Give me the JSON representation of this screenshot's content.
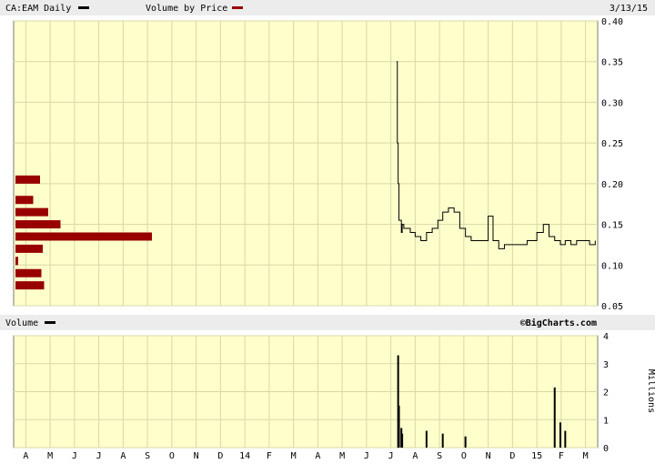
{
  "header": {
    "symbol_label": "CA:EAM Daily",
    "vbp_label": "Volume by Price",
    "date": "3/13/15"
  },
  "volume_header": {
    "label": "Volume",
    "watermark": "©BigCharts.com"
  },
  "colors": {
    "plot_bg": "#ffffcc",
    "grid": "#d8d8a8",
    "price_line": "#000000",
    "vbp_bar": "#990000",
    "bar_header": "#ececec"
  },
  "chart_data": [
    {
      "type": "line",
      "series": [
        {
          "values_x": [
            "2014-07-08",
            "2014-07-09",
            "2014-07-10",
            "2014-07-11",
            "2014-07-14",
            "2014-07-15",
            "2014-07-17",
            "2014-07-21",
            "2014-07-25",
            "2014-07-31",
            "2014-08-08",
            "2014-08-15",
            "2014-08-22",
            "2014-08-29",
            "2014-09-05",
            "2014-09-12",
            "2014-09-19",
            "2014-09-26",
            "2014-10-03",
            "2014-10-10",
            "2014-10-17",
            "2014-10-24",
            "2014-10-31",
            "2014-11-07",
            "2014-11-14",
            "2014-11-21",
            "2014-11-28",
            "2014-12-05",
            "2014-12-12",
            "2014-12-19",
            "2014-12-31",
            "2015-01-09",
            "2015-01-16",
            "2015-01-23",
            "2015-01-30",
            "2015-02-06",
            "2015-02-13",
            "2015-02-20",
            "2015-02-27",
            "2015-03-06",
            "2015-03-13"
          ],
          "values": [
            0.35,
            0.25,
            0.2,
            0.155,
            0.14,
            0.15,
            0.145,
            0.145,
            0.14,
            0.135,
            0.13,
            0.14,
            0.145,
            0.155,
            0.165,
            0.17,
            0.165,
            0.145,
            0.135,
            0.13,
            0.13,
            0.13,
            0.16,
            0.13,
            0.12,
            0.125,
            0.125,
            0.125,
            0.125,
            0.13,
            0.14,
            0.15,
            0.135,
            0.13,
            0.125,
            0.13,
            0.125,
            0.13,
            0.13,
            0.125,
            0.13
          ]
        }
      ],
      "xticks": [
        "A",
        "M",
        "J",
        "J",
        "A",
        "S",
        "O",
        "N",
        "D",
        "14",
        "F",
        "M",
        "A",
        "M",
        "J",
        "J",
        "A",
        "S",
        "O",
        "N",
        "D",
        "15",
        "F",
        "M"
      ],
      "yticks": [
        "0.40",
        "0.35",
        "0.30",
        "0.25",
        "0.20",
        "0.15",
        "0.10",
        "0.05"
      ],
      "ylim": [
        0.05,
        0.4
      ],
      "grid": true
    },
    {
      "type": "bar",
      "title": "Volume by Price",
      "price_levels": [
        0.075,
        0.09,
        0.105,
        0.12,
        0.135,
        0.15,
        0.165,
        0.18,
        0.205
      ],
      "relative_volume": [
        0.21,
        0.19,
        0.02,
        0.2,
        1.0,
        0.33,
        0.24,
        0.13,
        0.18
      ]
    },
    {
      "type": "bar",
      "title": "Volume",
      "ylabel": "Millions",
      "yticks": [
        "4",
        "3",
        "2",
        "1",
        "0"
      ],
      "ylim": [
        0,
        4
      ],
      "spikes": [
        {
          "x": "2014-07-10",
          "value": 3.3
        },
        {
          "x": "2014-07-11",
          "value": 1.5
        },
        {
          "x": "2014-07-14",
          "value": 0.7
        },
        {
          "x": "2014-07-15",
          "value": 0.5
        },
        {
          "x": "2014-08-15",
          "value": 0.6
        },
        {
          "x": "2014-09-05",
          "value": 0.5
        },
        {
          "x": "2014-10-03",
          "value": 0.4
        },
        {
          "x": "2015-01-23",
          "value": 2.15
        },
        {
          "x": "2015-01-30",
          "value": 0.9
        },
        {
          "x": "2015-02-06",
          "value": 0.6
        }
      ]
    }
  ]
}
